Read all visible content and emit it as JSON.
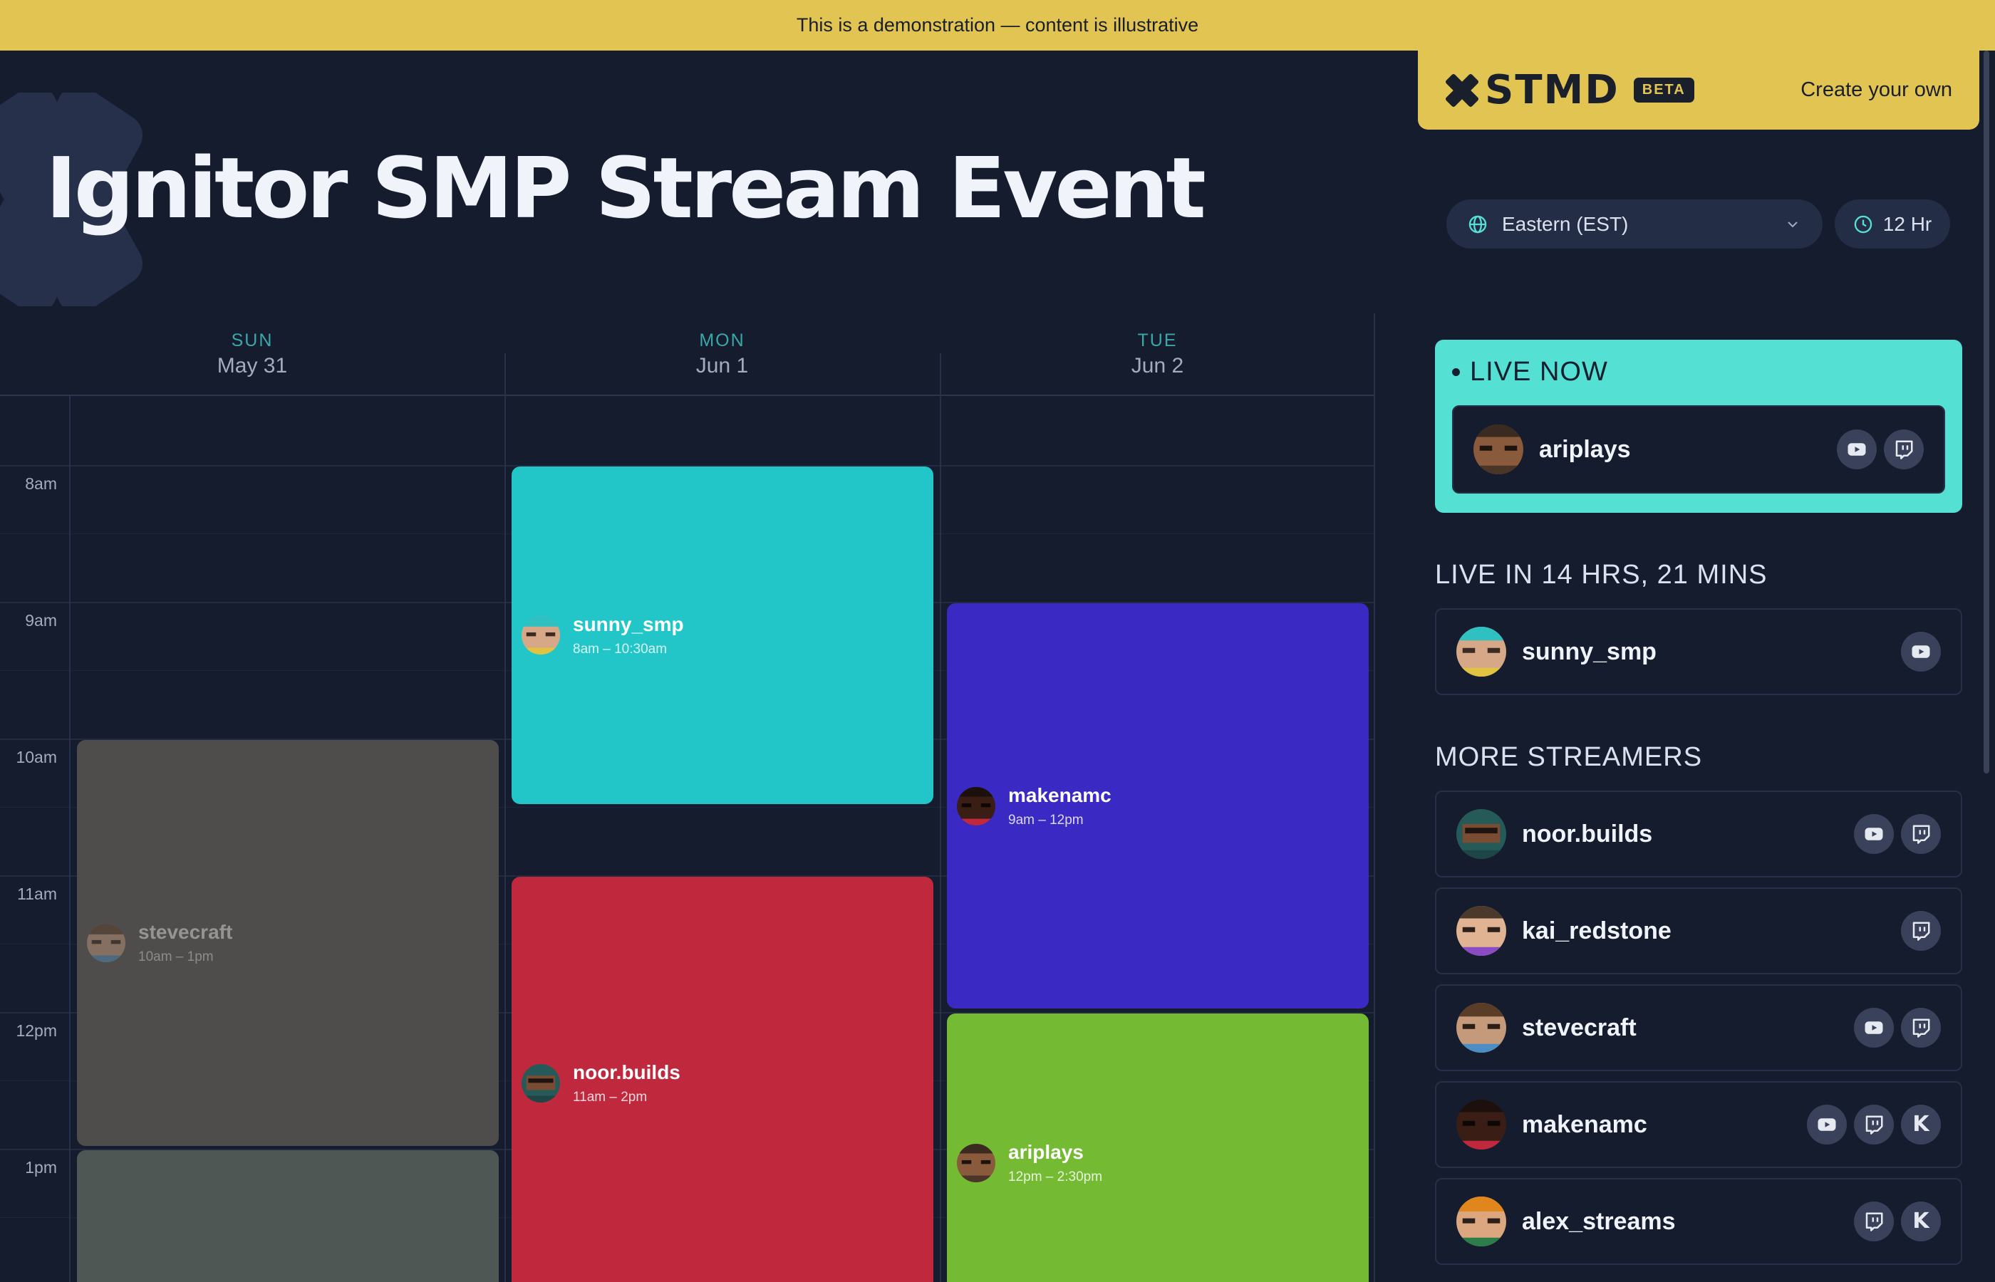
{
  "banner": {
    "text": "This is a demonstration — content is illustrative"
  },
  "brand": {
    "logo_icon": "x-logo-icon",
    "logo_text": "STMD",
    "badge": "BETA",
    "cta": "Create your own"
  },
  "page": {
    "title": "Ignitor SMP Stream Event"
  },
  "controls": {
    "timezone": {
      "icon": "globe-icon",
      "value": "Eastern (EST)",
      "dropdown_icon": "chevron-down-icon"
    },
    "clock_format": {
      "icon": "clock-icon",
      "value": "12 Hr"
    }
  },
  "calendar": {
    "days": [
      {
        "dow": "SUN",
        "date": "May 31"
      },
      {
        "dow": "MON",
        "date": "Jun 1"
      },
      {
        "dow": "TUE",
        "date": "Jun 2"
      }
    ],
    "hours": [
      "8am",
      "9am",
      "10am",
      "11am",
      "12pm",
      "1pm"
    ],
    "events": [
      {
        "name": "sunny_smp",
        "time": "8am – 10:30am",
        "color": "#23c6c8"
      },
      {
        "name": "noor.builds",
        "time": "11am – 2pm",
        "color": "#c0283d"
      },
      {
        "name": "makenamc",
        "time": "9am – 12pm",
        "color": "#3b29c3"
      },
      {
        "name": "ariplays",
        "time": "12pm – 2:30pm",
        "color": "#74ba33"
      },
      {
        "name": "stevecraft",
        "time": "10am – 1pm",
        "color": "#4f4d4b"
      },
      {
        "name": "",
        "time": "",
        "color": "#4e5754"
      }
    ]
  },
  "sidebar": {
    "live_now": {
      "title": "LIVE NOW",
      "streamer": {
        "name": "ariplays",
        "platforms": [
          "youtube-icon",
          "twitch-icon"
        ]
      }
    },
    "upcoming": {
      "title": "LIVE IN 14 HRS, 21 MINS",
      "streamer": {
        "name": "sunny_smp",
        "platforms": [
          "youtube-icon"
        ]
      }
    },
    "more": {
      "title": "MORE STREAMERS",
      "streamers": [
        {
          "name": "noor.builds",
          "platforms": [
            "youtube-icon",
            "twitch-icon"
          ]
        },
        {
          "name": "kai_redstone",
          "platforms": [
            "twitch-icon"
          ]
        },
        {
          "name": "stevecraft",
          "platforms": [
            "youtube-icon",
            "twitch-icon"
          ]
        },
        {
          "name": "makenamc",
          "platforms": [
            "youtube-icon",
            "twitch-icon",
            "kick-icon"
          ]
        },
        {
          "name": "alex_streams",
          "platforms": [
            "twitch-icon",
            "kick-icon"
          ]
        }
      ]
    }
  },
  "kick_letter": "K"
}
